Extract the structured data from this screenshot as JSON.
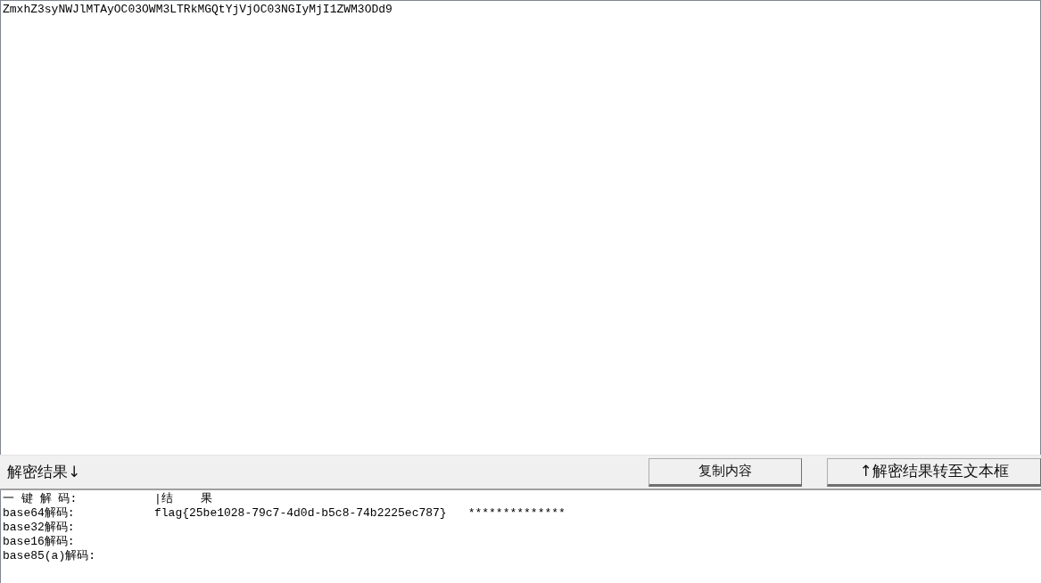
{
  "input": {
    "value": "ZmxhZ3syNWJlMTAyOC03OWM3LTRkMGQtYjVjOC03NGIyMjI1ZWM3ODd9"
  },
  "toolbar": {
    "label": "解密结果↓",
    "buttons": [
      "复制内容",
      "↑解密结果转至文本框"
    ]
  },
  "results": {
    "header": {
      "label": "一 键 解 码:",
      "result": "|结    果"
    },
    "rows": [
      {
        "label": "base64解码:",
        "result": "flag{25be1028-79c7-4d0d-b5c8-74b2225ec787}",
        "extra": "**************"
      },
      {
        "label": "base32解码:"
      },
      {
        "label": "base16解码:"
      },
      {
        "label": "base85(a)解码:"
      }
    ]
  }
}
